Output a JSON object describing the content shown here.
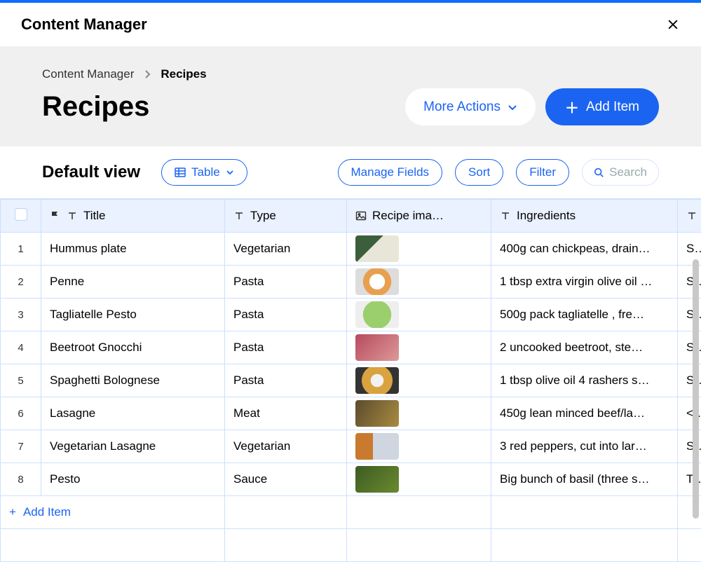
{
  "header": {
    "title": "Content Manager"
  },
  "breadcrumb": {
    "parent": "Content Manager",
    "current": "Recipes"
  },
  "page": {
    "title": "Recipes"
  },
  "actions": {
    "more": "More Actions",
    "add": "Add Item"
  },
  "viewbar": {
    "view_name": "Default view",
    "table_label": "Table",
    "manage_fields": "Manage Fields",
    "sort": "Sort",
    "filter": "Filter",
    "search_placeholder": "Search"
  },
  "columns": {
    "title": "Title",
    "type": "Type",
    "image": "Recipe ima…",
    "ingredients": "Ingredients"
  },
  "rows": [
    {
      "n": "1",
      "title": "Hummus plate",
      "type": "Vegetarian",
      "ingredients": "400g can chickpeas, drain…",
      "extra": "S"
    },
    {
      "n": "2",
      "title": "Penne",
      "type": "Pasta",
      "ingredients": "1 tbsp extra virgin olive oil …",
      "extra": "S"
    },
    {
      "n": "3",
      "title": "Tagliatelle Pesto",
      "type": "Pasta",
      "ingredients": "500g pack tagliatelle , fre…",
      "extra": "S"
    },
    {
      "n": "4",
      "title": "Beetroot Gnocchi",
      "type": "Pasta",
      "ingredients": "2 uncooked beetroot, ste…",
      "extra": "S"
    },
    {
      "n": "5",
      "title": "Spaghetti Bolognese",
      "type": "Pasta",
      "ingredients": "1 tbsp olive oil 4 rashers s…",
      "extra": "S"
    },
    {
      "n": "6",
      "title": "Lasagne",
      "type": "Meat",
      "ingredients": "450g lean minced beef/la…",
      "extra": "<"
    },
    {
      "n": "7",
      "title": "Vegetarian Lasagne",
      "type": "Vegetarian",
      "ingredients": "3 red peppers, cut into lar…",
      "extra": "S"
    },
    {
      "n": "8",
      "title": "Pesto",
      "type": "Sauce",
      "ingredients": "Big bunch of basil (three s…",
      "extra": "T"
    }
  ],
  "footer": {
    "add_item": "Add Item"
  }
}
